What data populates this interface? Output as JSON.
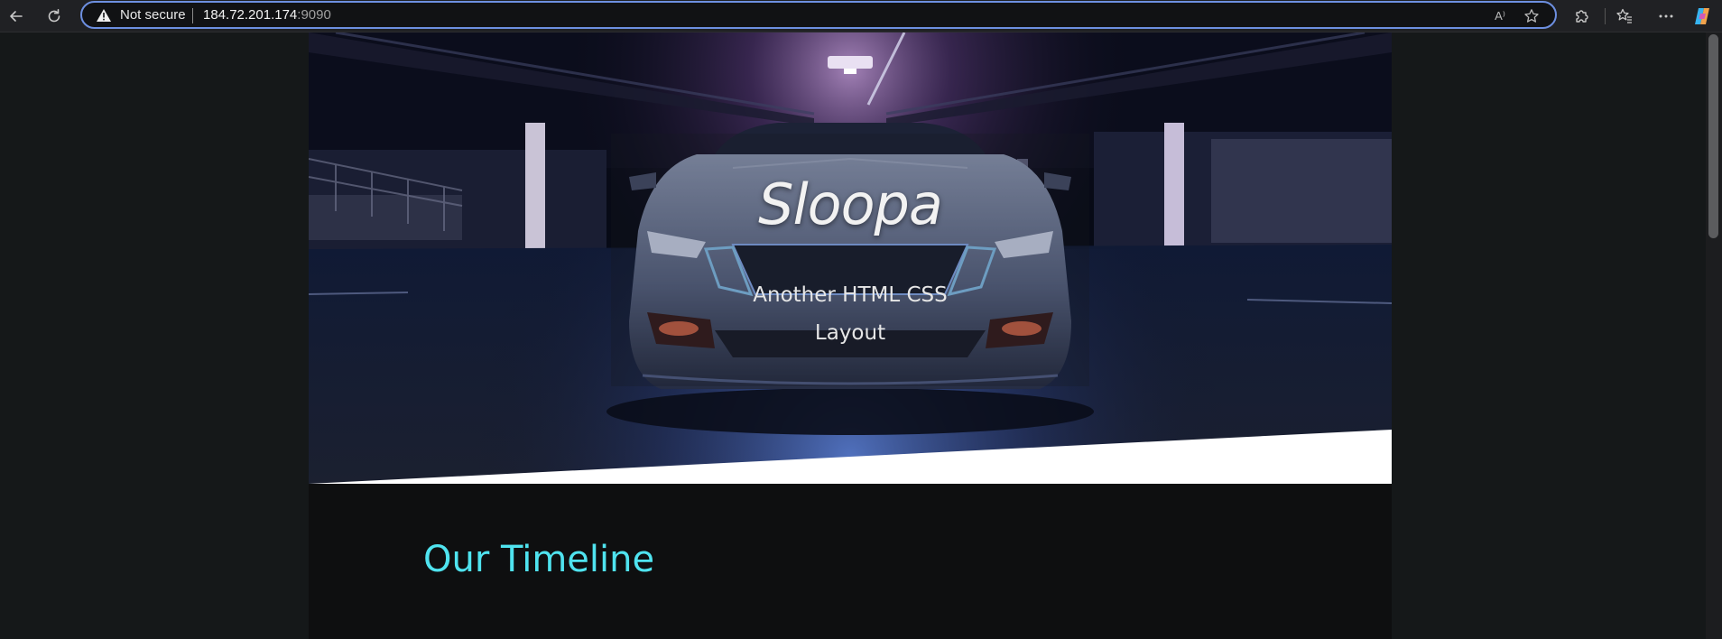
{
  "browser": {
    "security_label": "Not secure",
    "url_host": "184.72.201.174",
    "url_port": ":9090",
    "read_aloud_icon": "read-aloud-icon",
    "favorite_icon": "star-icon",
    "extensions_icon": "puzzle-icon",
    "favorites_icon": "favorites-list-icon",
    "menu_icon": "ellipsis-icon",
    "copilot_icon": "copilot-icon",
    "read_aloud_glyph": "A⁾"
  },
  "hero": {
    "title": "Sloopa",
    "subtitle_line1": "Another HTML CSS",
    "subtitle_line2": "Layout"
  },
  "timeline": {
    "heading": "Our Timeline"
  },
  "colors": {
    "accent": "#4fe3ef",
    "page_bg": "#0e0f10",
    "outer_bg": "#151819",
    "address_border": "#6d8fe0"
  }
}
